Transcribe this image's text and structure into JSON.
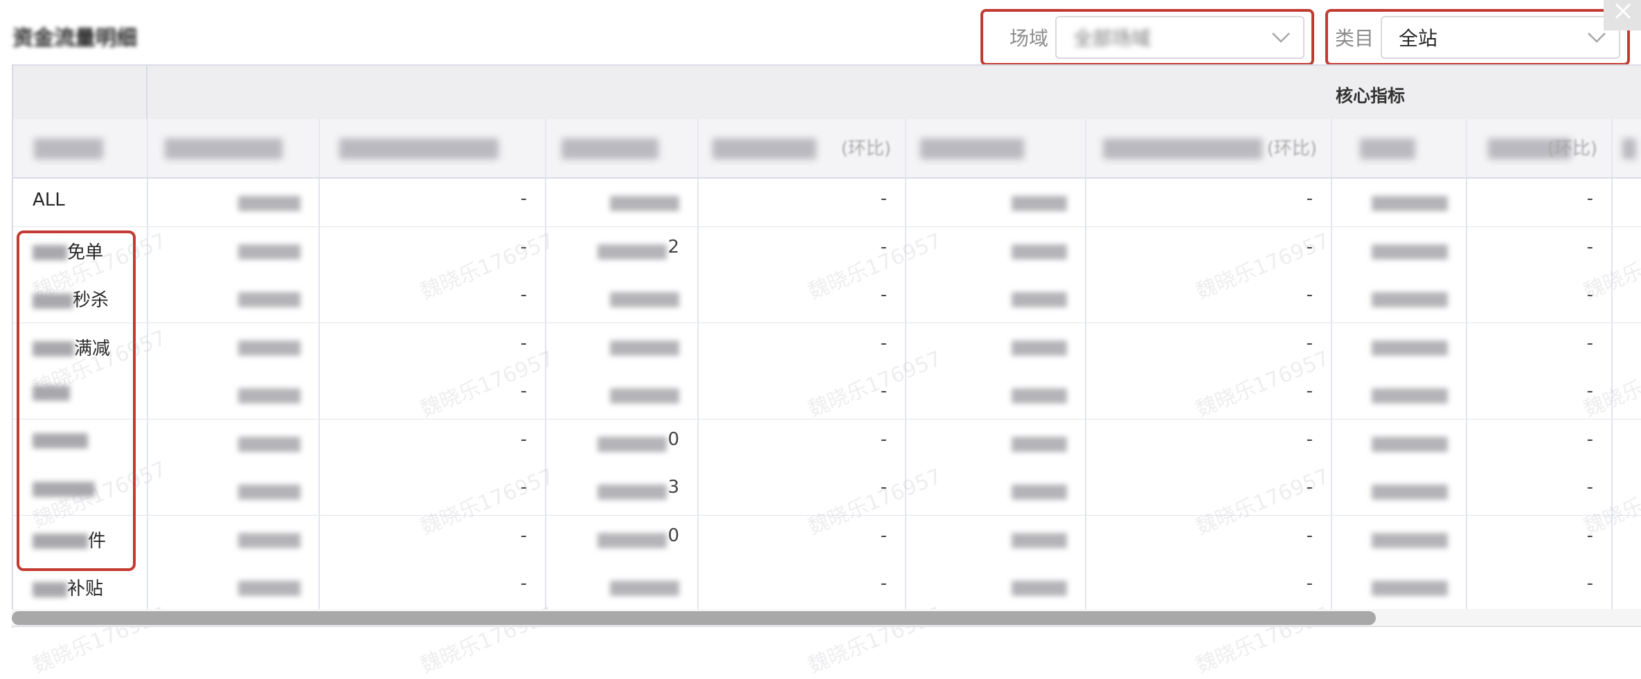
{
  "page": {
    "title": "资金流量明细"
  },
  "filters": {
    "scene": {
      "label": "场域",
      "value": "全部场域"
    },
    "category": {
      "label": "类目",
      "value": "全站"
    }
  },
  "table": {
    "group_header": "核心指标",
    "column_headers": [
      "",
      "",
      "",
      "",
      "(环比)",
      "",
      "(环比)",
      "",
      "(环比)",
      ""
    ],
    "rows": [
      {
        "name": "ALL",
        "values": [
          "",
          "-",
          "",
          "-",
          "",
          "-",
          "",
          "-"
        ]
      },
      {
        "name_suffix": "免单",
        "values": [
          "",
          "-",
          "2",
          "-",
          "",
          "-",
          "",
          "-"
        ]
      },
      {
        "name_suffix": "秒杀",
        "values": [
          "",
          "-",
          "",
          "-",
          "",
          "-",
          "",
          "-"
        ]
      },
      {
        "name_suffix": "满减",
        "values": [
          "",
          "-",
          "",
          "-",
          "",
          "-",
          "",
          "-"
        ]
      },
      {
        "name_suffix": "",
        "values": [
          "",
          "-",
          "",
          "-",
          "",
          "-",
          "",
          "-"
        ]
      },
      {
        "name_suffix": "",
        "values": [
          "",
          "-",
          "0",
          "-",
          "",
          "-",
          "",
          "-"
        ]
      },
      {
        "name_suffix": "",
        "values": [
          "",
          "-",
          "3",
          "-",
          "",
          "-",
          "",
          "-"
        ]
      },
      {
        "name_suffix": "件",
        "values": [
          "",
          "-",
          "0",
          "-",
          "",
          "-",
          "",
          "-"
        ]
      },
      {
        "name_suffix": "补贴",
        "values": [
          "",
          "-",
          "",
          "-",
          "",
          "-",
          "",
          "-"
        ]
      }
    ]
  },
  "watermark": "魏晓乐176957",
  "icons": {
    "chevron": "chevron-down-icon",
    "close": "close-icon"
  }
}
